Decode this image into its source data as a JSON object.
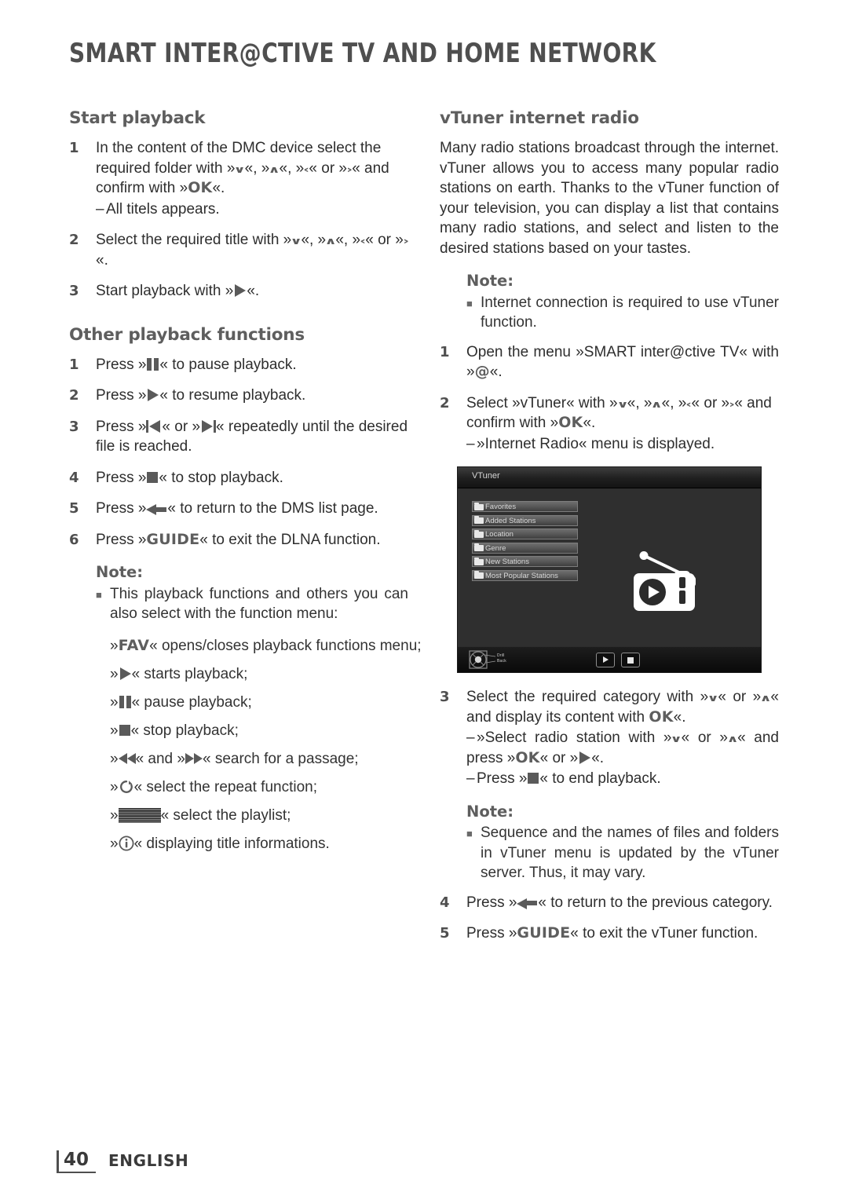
{
  "document": {
    "header_title": "SMART INTER@CTIVE TV AND HOME NETWORK",
    "footer": {
      "page_number": "40",
      "language": "ENGLISH"
    }
  },
  "left_column": {
    "section1": {
      "heading": "Start playback",
      "steps": [
        {
          "num": "1",
          "parts": [
            "In the content of the DMC device select the required folder with »",
            "«, »",
            "«, »",
            "« or »",
            "« and confirm with »",
            "«."
          ],
          "dash": "All titels appears."
        },
        {
          "num": "2",
          "parts": [
            "Select the required title with »",
            "«, »",
            "«, »",
            "« or »",
            "«."
          ]
        },
        {
          "num": "3",
          "parts": [
            "Start playback with »",
            "«."
          ]
        }
      ]
    },
    "section2": {
      "heading": "Other playback functions",
      "steps": [
        {
          "num": "1",
          "pre": "Press »",
          "post": "« to pause playback."
        },
        {
          "num": "2",
          "pre": "Press »",
          "post": "« to resume playback."
        },
        {
          "num": "3",
          "pre": "Press »",
          "mid": "« or »",
          "post": "« repeatedly until the desired file is reached."
        },
        {
          "num": "4",
          "pre": "Press »",
          "post": "« to stop playback."
        },
        {
          "num": "5",
          "pre": "Press »",
          "post": "« to return to the DMS list page."
        },
        {
          "num": "6",
          "pre": "Press »",
          "key": "GUIDE",
          "post": "« to exit the DLNA function."
        }
      ],
      "note": {
        "title": "Note:",
        "bullet": "This playback functions and others you can also select with the function menu:",
        "items": [
          {
            "pre": "»",
            "key": "FAV",
            "post": "« opens/closes playback functions menu;"
          },
          {
            "pre": "»",
            "post": "« starts playback;"
          },
          {
            "pre": "»",
            "post": "« pause playback;"
          },
          {
            "pre": "»",
            "post": "« stop playback;"
          },
          {
            "pre": "»",
            "mid": "« and »",
            "post": "« search for a passage;"
          },
          {
            "pre": "»",
            "post": "« select the repeat function;"
          },
          {
            "pre": "»",
            "post": "« select the playlist;"
          },
          {
            "pre": "»",
            "post": "« displaying title informations."
          }
        ]
      }
    }
  },
  "right_column": {
    "heading": "vTuner internet radio",
    "intro": "Many radio stations broadcast through the internet. vTuner allows you to access many popular radio stations on earth. Thanks to the vTuner function of your television, you can display a list that contains many radio stations, and select and listen to the desired stations based on your tastes.",
    "note1": {
      "title": "Note:",
      "bullet": "Internet connection is required to use vTuner function."
    },
    "steps_before_image": [
      {
        "num": "1",
        "pre": "Open the menu »SMART inter@ctive TV« with »",
        "key": "@",
        "post": "«."
      },
      {
        "num": "2",
        "parts": [
          "Select »vTuner« with »",
          "«, »",
          "«, »",
          "« or »",
          "« and confirm with »",
          "«."
        ],
        "dash": "»Internet Radio« menu is displayed."
      }
    ],
    "tv_screenshot": {
      "title": "VTuner",
      "menu_items": [
        "Favorites",
        "Added Stations",
        "Location",
        "Genre",
        "New Stations",
        "Most Popular Stations"
      ],
      "statusbar_labels": "Drill\nBack",
      "buttons": [
        "play",
        "stop"
      ]
    },
    "steps_after_image": [
      {
        "num": "3",
        "parts": [
          "Select the required category with »",
          "« or »",
          "« and display its content with ",
          "«."
        ],
        "key": "OK",
        "dash1_parts": [
          "»Select radio station with »",
          "« or »",
          "« and press »",
          "« or »",
          "«."
        ],
        "dash1_key": "OK",
        "dash2_parts": [
          "Press »",
          "« to end playback."
        ]
      }
    ],
    "note2": {
      "title": "Note:",
      "bullet": "Sequence and the names of files and folders in vTuner menu is updated by the vTuner server. Thus, it may vary."
    },
    "steps_tail": [
      {
        "num": "4",
        "pre": "Press »",
        "post": "« to return to the previous category."
      },
      {
        "num": "5",
        "pre": "Press »",
        "key": "GUIDE",
        "post": "« to exit the vTuner function."
      }
    ]
  },
  "glyphs": {
    "down": "∨",
    "up": "∧",
    "left": "‹",
    "right": "›",
    "ok": "OK"
  },
  "colors": {
    "heading": "#5e5e5e",
    "body": "#2e2e2e",
    "glyph": "#5a5a5a",
    "tv_background": "#2f2f2f"
  }
}
